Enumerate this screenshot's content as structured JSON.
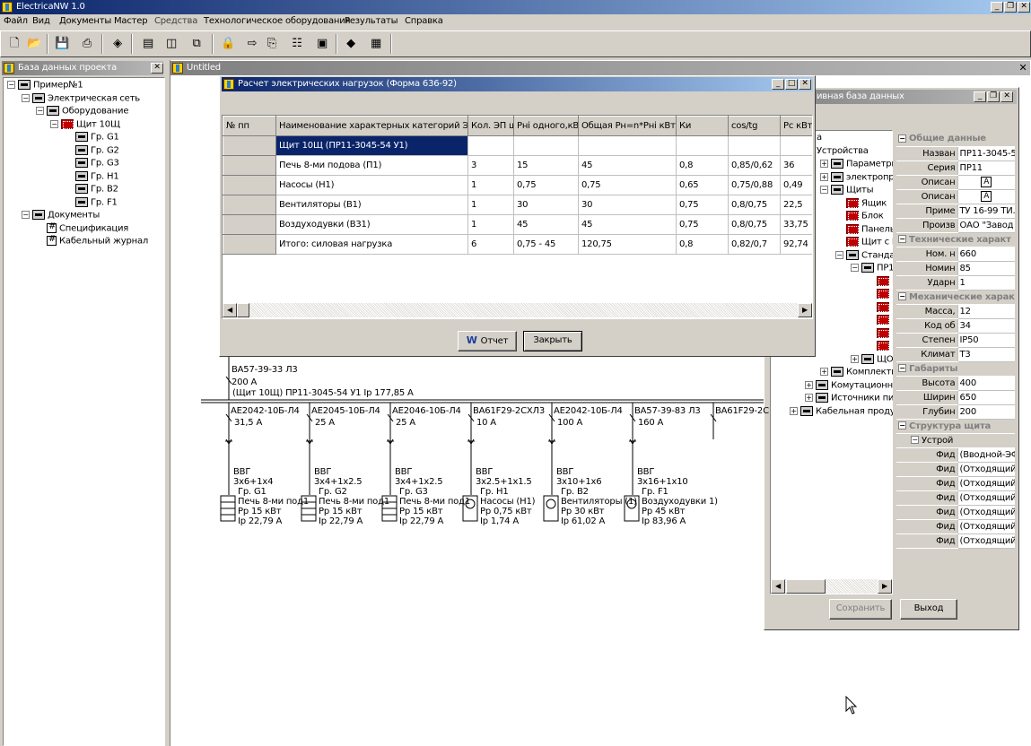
{
  "app": {
    "title": "ElectricaNW 1.0"
  },
  "menu": [
    "Файл",
    "Вид",
    "Документы",
    "Мастер",
    "Средства",
    "Технологическое оборудования",
    "Результаты",
    "Справка"
  ],
  "toolbar": {
    "icons": [
      "new-file-icon",
      "open-folder-icon",
      "save-icon",
      "print-icon",
      "database-icon",
      "panel-h-icon",
      "panel-v-icon",
      "windows-icon",
      "folder-lock-icon",
      "export-icon",
      "calc-icon",
      "properties-icon",
      "device-icon",
      "diamond-icon",
      "table-icon"
    ]
  },
  "left_panel": {
    "title": "База данных проекта",
    "tree": [
      {
        "label": "Пример№1",
        "sign": "−",
        "icon": "board"
      },
      {
        "label": "Электрическая сеть",
        "sign": "−",
        "icon": "board"
      },
      {
        "label": "Оборудование",
        "sign": "−",
        "icon": "board"
      },
      {
        "label": "Щит 10Щ",
        "sign": "−",
        "icon": "red"
      },
      {
        "label": "Гр. G1",
        "icon": "board"
      },
      {
        "label": "Гр. G2",
        "icon": "board"
      },
      {
        "label": "Гр. G3",
        "icon": "board"
      },
      {
        "label": "Гр. H1",
        "icon": "board"
      },
      {
        "label": "Гр. B2",
        "icon": "board"
      },
      {
        "label": "Гр. F1",
        "icon": "board"
      },
      {
        "label": "Документы",
        "sign": "−",
        "icon": "board"
      },
      {
        "label": "Спецификация",
        "icon": "doc"
      },
      {
        "label": "Кабельный журнал",
        "icon": "doc"
      }
    ]
  },
  "doc_window": {
    "title": "Untitled"
  },
  "calc_dialog": {
    "title": "Расчет электрических нагрузок (Форма 636-92)",
    "columns": [
      "№ пп",
      "Наименование характерных категорий ЭП",
      "Кол. ЭП шт",
      "Рнi одного,кВт",
      "Общая Рн=n*Рнi кВт",
      "Ки",
      "cos/tg",
      "Рс кВт"
    ],
    "rows": [
      [
        "",
        "Щит 10Щ  (ПР11-3045-54 У1)",
        "",
        "",
        "",
        "",
        "",
        ""
      ],
      [
        "",
        "Печь 8-ми подова (П1)",
        "3",
        "15",
        "45",
        "0,8",
        "0,85/0,62",
        "36"
      ],
      [
        "",
        "Насосы (Н1)",
        "1",
        "0,75",
        "0,75",
        "0,65",
        "0,75/0,88",
        "0,49"
      ],
      [
        "",
        "Вентиляторы (В1)",
        "1",
        "30",
        "30",
        "0,75",
        "0,8/0,75",
        "22,5"
      ],
      [
        "",
        "Воздуходувки (В31)",
        "1",
        "45",
        "45",
        "0,75",
        "0,8/0,75",
        "33,75"
      ],
      [
        "",
        "Итого: силовая нагрузка",
        "6",
        "0,75 - 45",
        "120,75",
        "0,8",
        "0,82/0,7",
        "92,74"
      ]
    ],
    "report_button": "Отчет",
    "close_button": "Закрыть"
  },
  "schematic": {
    "main_breaker": "ВА57-39-33 Л3",
    "main_current": "200  А",
    "bus_label": "(Щит 10Щ)  ПР11-3045-54 У1 Ip 177,85 А",
    "feeders": [
      {
        "breaker": "АЕ2042-10Б-Л4",
        "current": "31,5  А",
        "cable": "ВВГ",
        "section": "3x6+1x4",
        "group": "Гр. G1",
        "load": "Печь 8-ми под1",
        "power": "Рр 15 кВт",
        "ip": "Ip 22,79 А",
        "sym": "rect"
      },
      {
        "breaker": "АЕ2045-10Б-Л4",
        "current": "25  А",
        "cable": "ВВГ",
        "section": "3x4+1x2.5",
        "group": "Гр. G2",
        "load": "Печь 8-ми под1",
        "power": "Рр 15 кВт",
        "ip": "Ip 22,79 А",
        "sym": "rect"
      },
      {
        "breaker": "АЕ2046-10Б-Л4",
        "current": "25  А",
        "cable": "ВВГ",
        "section": "3x4+1x2.5",
        "group": "Гр. G3",
        "load": "Печь 8-ми под1",
        "power": "Рр 15 кВт",
        "ip": "Ip 22,79 А",
        "sym": "rect"
      },
      {
        "breaker": "ВА61F29-2СХЛ3",
        "current": "10  А",
        "cable": "ВВГ",
        "section": "3x2.5+1x1.5",
        "group": "Гр. H1",
        "load": "Насосы (Н1)",
        "power": "Рр 0,75 кВт",
        "ip": "Ip 1,74 А",
        "sym": "circle"
      },
      {
        "breaker": "АЕ2042-10Б-Л4",
        "current": "100  А",
        "cable": "ВВГ",
        "section": "3x10+1x6",
        "group": "Гр. B2",
        "load": "Вентиляторы (1)",
        "power": "Рр 30 кВт",
        "ip": "Ip 61,02 А",
        "sym": "circle"
      },
      {
        "breaker": "ВА57-39-83 Л3",
        "current": "160  А",
        "cable": "ВВГ",
        "section": "3x16+1x10",
        "group": "Гр. F1",
        "load": "Воздуходувки 1)",
        "power": "Рр 45 кВт",
        "ip": "Ip 83,96 А",
        "sym": "circle"
      },
      {
        "breaker": "ВА61F29-2С",
        "current": "",
        "cable": "",
        "section": "",
        "group": "",
        "load": "",
        "power": "",
        "ip": "",
        "sym": "none"
      }
    ]
  },
  "db_window": {
    "title": "ивная база данных",
    "tree": [
      {
        "label": "а"
      },
      {
        "label": "Устройства"
      },
      {
        "label": "Параметры",
        "sign": "+",
        "icon": "board"
      },
      {
        "label": "электроприем",
        "sign": "+",
        "icon": "board"
      },
      {
        "label": "Щиты",
        "sign": "−",
        "icon": "board"
      },
      {
        "label": "Ящик",
        "icon": "red"
      },
      {
        "label": "Блок",
        "icon": "red"
      },
      {
        "label": "Панель",
        "icon": "red"
      },
      {
        "label": "Щит с DIN",
        "icon": "red"
      },
      {
        "label": "Стандартн",
        "sign": "−",
        "icon": "board"
      },
      {
        "label": "ПР11",
        "sign": "−",
        "icon": "board"
      },
      {
        "label": "ПР",
        "icon": "red"
      },
      {
        "label": "ПР",
        "icon": "red"
      },
      {
        "label": "ПР",
        "icon": "red"
      },
      {
        "label": "ПР",
        "icon": "red"
      },
      {
        "label": "ПР",
        "icon": "red"
      },
      {
        "label": "ПР",
        "icon": "red"
      },
      {
        "label": "ЩО70",
        "sign": "+",
        "icon": "board"
      },
      {
        "label": "Комплекти",
        "sign": "+",
        "icon": "board"
      },
      {
        "label": "Комутационны",
        "sign": "+",
        "icon": "board"
      },
      {
        "label": "Источники пи",
        "sign": "+",
        "icon": "board"
      },
      {
        "label": "Кабельная продук",
        "sign": "+",
        "icon": "board"
      }
    ],
    "inspector": [
      {
        "cat": "Общие данные"
      },
      {
        "l": "Назван",
        "v": "ПР11-3045-5"
      },
      {
        "l": "Серия",
        "v": "ПР11"
      },
      {
        "l": "Описан",
        "v": "A",
        "btn": true
      },
      {
        "l": "Описан",
        "v": "A",
        "btn": true
      },
      {
        "l": "Приме",
        "v": "ТУ 16-99 ТИ."
      },
      {
        "l": "Произв",
        "v": "ОАО \"Завод"
      },
      {
        "cat": "Технические характ"
      },
      {
        "l": "Ном. н",
        "v": "660"
      },
      {
        "l": "Номин",
        "v": "85"
      },
      {
        "l": "Ударн",
        "v": "1"
      },
      {
        "cat": "Механические харак"
      },
      {
        "l": "Масса,",
        "v": "12"
      },
      {
        "l": "Код об",
        "v": "34"
      },
      {
        "l": "Степен",
        "v": "IP50"
      },
      {
        "l": "Климат",
        "v": "Т3"
      },
      {
        "cat": "Габариты"
      },
      {
        "l": "Высота",
        "v": "400"
      },
      {
        "l": "Ширин",
        "v": "650"
      },
      {
        "l": "Глубин",
        "v": "200"
      },
      {
        "cat": "Структура щита"
      },
      {
        "l": "Устрой",
        "v": "",
        "sub": true
      },
      {
        "l": "Фид",
        "v": "(Вводной-ЭФ"
      },
      {
        "l": "Фид",
        "v": "(Отходящий:"
      },
      {
        "l": "Фид",
        "v": "(Отходящий:"
      },
      {
        "l": "Фид",
        "v": "(Отходящий:"
      },
      {
        "l": "Фид",
        "v": "(Отходящий:"
      },
      {
        "l": "Фид",
        "v": "(Отходящий:"
      },
      {
        "l": "Фид",
        "v": "(Отходящий:"
      }
    ],
    "save_button": "Сохранить",
    "exit_button": "Выход"
  }
}
